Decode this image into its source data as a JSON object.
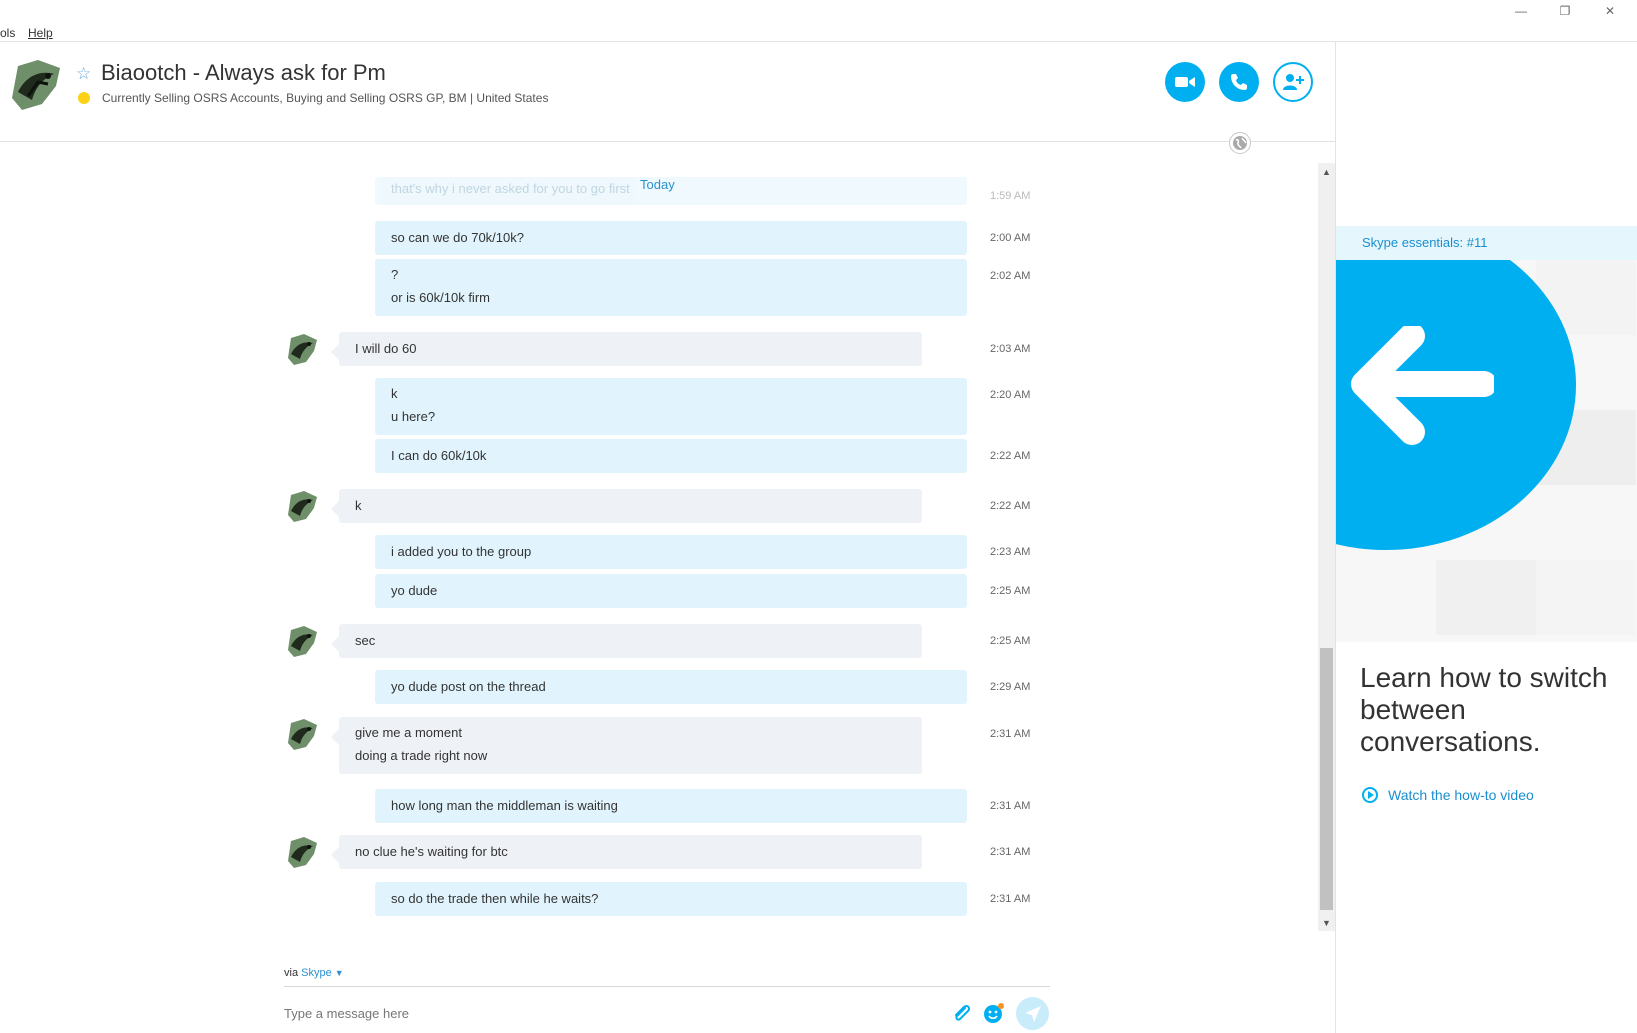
{
  "menu": {
    "tools": "ols",
    "help": "Help"
  },
  "window_controls": {
    "minimize": "—",
    "restore": "❐",
    "close": "✕"
  },
  "header": {
    "contact_name": "Biaootch - Always ask for Pm",
    "mood": "Currently Selling OSRS Accounts, Buying and Selling OSRS GP, BM  |  United States",
    "status_color": "#fcd116"
  },
  "today_label": "Today",
  "faded_message": {
    "text": "that's why i never asked for you to go first",
    "time": "1:59 AM"
  },
  "messages": [
    {
      "dir": "out",
      "lines": [
        "so can we do 70k/10k?"
      ],
      "time": "2:00 AM"
    },
    {
      "dir": "out",
      "lines": [
        "?",
        "or is 60k/10k firm"
      ],
      "time": "2:02 AM"
    },
    {
      "dir": "in",
      "lines": [
        "I will do 60"
      ],
      "time": "2:03 AM"
    },
    {
      "dir": "out",
      "lines": [
        "k",
        "u here?"
      ],
      "time": "2:20 AM"
    },
    {
      "dir": "out",
      "lines": [
        "I can do 60k/10k"
      ],
      "time": "2:22 AM"
    },
    {
      "dir": "in",
      "lines": [
        "k"
      ],
      "time": "2:22 AM"
    },
    {
      "dir": "out",
      "lines": [
        "i added you to the group"
      ],
      "time": "2:23 AM"
    },
    {
      "dir": "out",
      "lines": [
        "yo dude"
      ],
      "time": "2:25 AM"
    },
    {
      "dir": "in",
      "lines": [
        "sec"
      ],
      "time": "2:25 AM"
    },
    {
      "dir": "out",
      "lines": [
        "yo dude post on the thread"
      ],
      "time": "2:29 AM"
    },
    {
      "dir": "in",
      "lines": [
        "give me a moment",
        "doing a trade right now"
      ],
      "time": "2:31 AM"
    },
    {
      "dir": "out",
      "lines": [
        "how long man the middleman is waiting"
      ],
      "time": "2:31 AM"
    },
    {
      "dir": "in",
      "lines": [
        "no clue he's waiting for btc"
      ],
      "time": "2:31 AM"
    },
    {
      "dir": "out",
      "lines": [
        "so do the trade then while he waits?"
      ],
      "time": "2:31 AM"
    }
  ],
  "composer": {
    "via_prefix": "via",
    "via_service": "Skype",
    "placeholder": "Type a message here"
  },
  "tip": {
    "label": "Skype essentials: #11",
    "headline": "Learn how to switch between conversations.",
    "link": "Watch the how-to video"
  },
  "colors": {
    "accent": "#00aff0",
    "bubble_out": "#e1f4fd",
    "bubble_in": "#eef2f6"
  }
}
